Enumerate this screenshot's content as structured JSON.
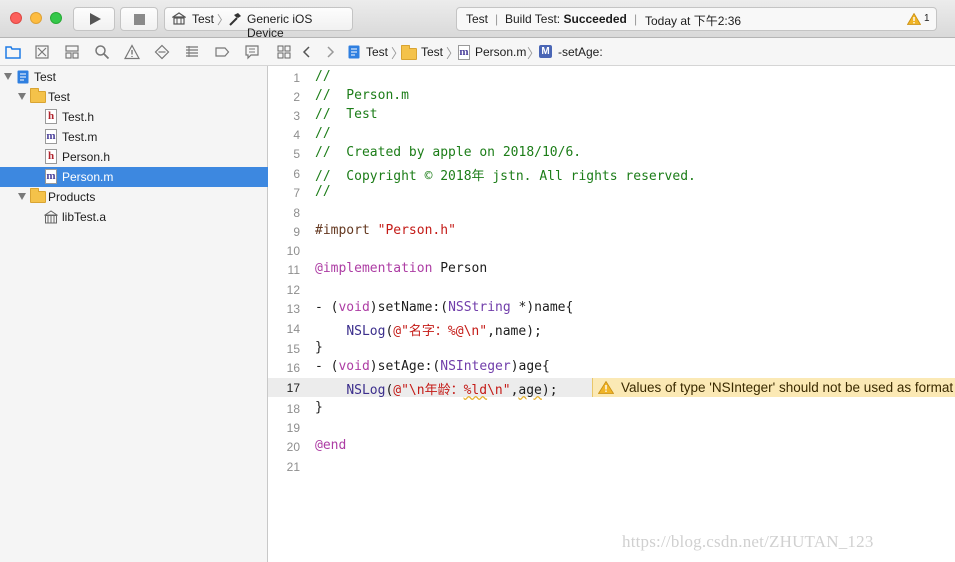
{
  "toolbar": {
    "scheme_name": "Test",
    "destination": "Generic iOS Device",
    "activity": {
      "project": "Test",
      "build_prefix": "Build Test: ",
      "build_status": "Succeeded",
      "time": "Today at 下午2:36",
      "warning_count": "1"
    }
  },
  "navigator": {
    "tabs": [
      "folder-icon",
      "source-control-icon",
      "symbol-icon",
      "search-icon",
      "issue-icon",
      "test-icon",
      "debug-icon",
      "breakpoint-icon",
      "report-icon"
    ],
    "project": "Test",
    "group": "Test",
    "files": [
      "Test.h",
      "Test.m",
      "Person.h",
      "Person.m"
    ],
    "products_group": "Products",
    "product": "libTest.a"
  },
  "jumpbar": {
    "items": [
      "Test",
      "Test",
      "Person.m",
      "-setAge:"
    ]
  },
  "editor": {
    "lines": [
      "//",
      "//  Person.m",
      "//  Test",
      "//",
      "//  Created by apple on 2018/10/6.",
      "//  Copyright © 2018年 jstn. All rights reserved.",
      "//",
      "",
      "#import \"Person.h\"",
      "",
      "@implementation Person",
      "",
      "- (void)setName:(NSString *)name{",
      "    NSLog(@\"名字：%@\\n\",name);",
      "}",
      "- (void)setAge:(NSInteger)age{",
      "    NSLog(@\"\\n年龄：%ld\\n\",age);",
      "}",
      "",
      "@end",
      ""
    ],
    "line_numbers": [
      "1",
      "2",
      "3",
      "4",
      "5",
      "6",
      "7",
      "8",
      "9",
      "10",
      "11",
      "12",
      "13",
      "14",
      "15",
      "16",
      "17",
      "18",
      "19",
      "20",
      "21"
    ],
    "current_line": "17",
    "issue_text": "Values of type 'NSInteger' should not be used as format arguments; add an explicit cast to 'long' instead"
  },
  "watermark": "https://blog.csdn.net/ZHUTAN_123"
}
